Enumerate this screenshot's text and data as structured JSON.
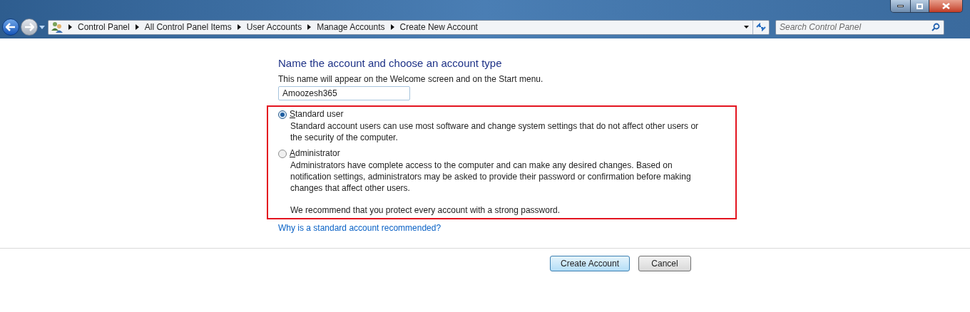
{
  "breadcrumb": [
    "Control Panel",
    "All Control Panel Items",
    "User Accounts",
    "Manage Accounts",
    "Create New Account"
  ],
  "search": {
    "placeholder": "Search Control Panel"
  },
  "heading": "Name the account and choose an account type",
  "name_hint": "This name will appear on the Welcome screen and on the Start menu.",
  "name_field": {
    "value": "Amoozesh365"
  },
  "account_types": [
    {
      "label": "Standard user",
      "selected": true,
      "description": "Standard account users can use most software and change system settings that do not affect other users or the security of the computer."
    },
    {
      "label": "Administrator",
      "selected": false,
      "description": "Administrators have complete access to the computer and can make any desired changes. Based on notification settings, administrators may be asked to provide their password or confirmation before making changes that affect other users."
    }
  ],
  "recommendation": "We recommend that you protect every account with a strong password.",
  "help_link": "Why is a standard account recommended?",
  "buttons": [
    {
      "label": "Create Account",
      "kind": "default"
    },
    {
      "label": "Cancel",
      "kind": "normal"
    }
  ]
}
